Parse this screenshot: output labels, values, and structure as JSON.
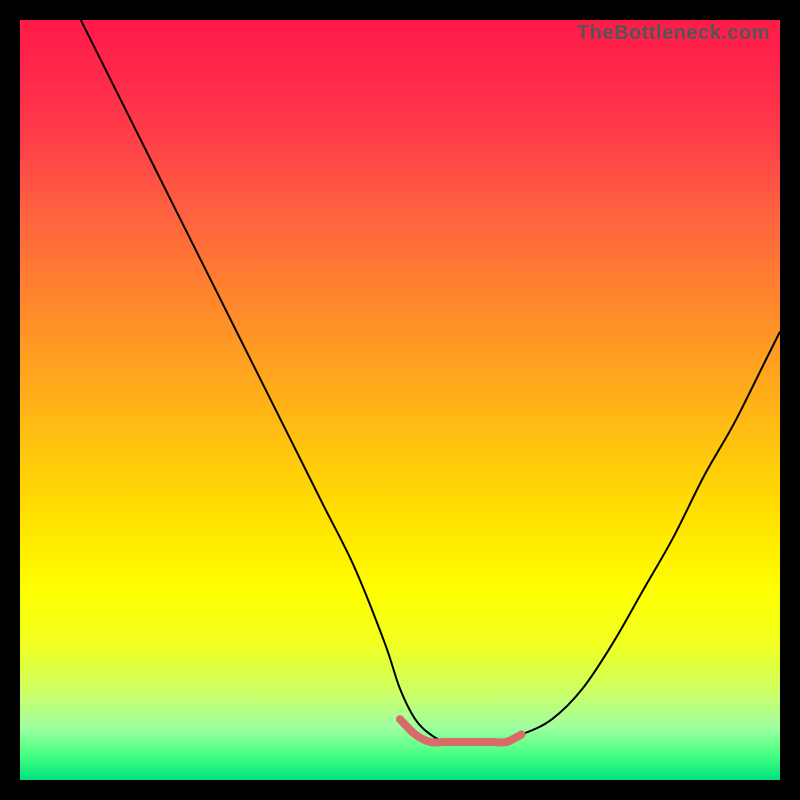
{
  "watermark": "TheBottleneck.com",
  "chart_data": {
    "type": "line",
    "title": "",
    "xlabel": "",
    "ylabel": "",
    "xlim": [
      0,
      100
    ],
    "ylim": [
      0,
      100
    ],
    "gradient_colors": {
      "top": "#ff1a4a",
      "mid_upper": "#ff8030",
      "mid": "#ffe000",
      "mid_lower": "#f0ff20",
      "bottom": "#00e080"
    },
    "series": [
      {
        "name": "main-curve",
        "color": "#000000",
        "stroke_width": 2,
        "x": [
          8,
          12,
          16,
          20,
          24,
          28,
          32,
          36,
          40,
          44,
          48,
          50,
          52,
          54,
          56,
          58,
          62,
          66,
          70,
          74,
          78,
          82,
          86,
          90,
          94,
          98,
          100
        ],
        "y": [
          100,
          92,
          84,
          76,
          68,
          60,
          52,
          44,
          36,
          28,
          18,
          12,
          8,
          6,
          5,
          5,
          5,
          6,
          8,
          12,
          18,
          25,
          32,
          40,
          47,
          55,
          59
        ]
      },
      {
        "name": "highlight-segment",
        "color": "#d86a6a",
        "stroke_width": 8,
        "x": [
          50,
          52,
          54,
          56,
          58,
          60,
          62,
          64,
          66
        ],
        "y": [
          8,
          6,
          5,
          5,
          5,
          5,
          5,
          5,
          6
        ]
      }
    ]
  }
}
